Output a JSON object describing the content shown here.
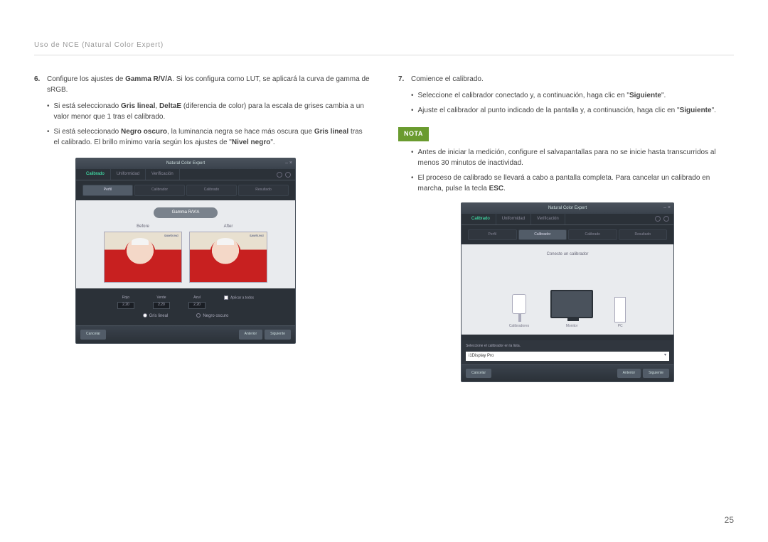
{
  "header": "Uso de NCE (Natural Color Expert)",
  "left": {
    "step6_num": "6.",
    "step6_a": "Configure los ajustes de ",
    "step6_b": "Gamma R/V/A",
    "step6_c": ". Si los configura como LUT, se aplicará la curva de gamma de sRGB.",
    "b1_a": "Si está seleccionado ",
    "b1_b": "Gris lineal",
    "b1_c": ", ",
    "b1_d": "DeltaE",
    "b1_e": " (diferencia de color) para la escala de grises cambia a un valor menor que 1 tras el calibrado.",
    "b2_a": "Si está seleccionado ",
    "b2_b": "Negro oscuro",
    "b2_c": ", la luminancia negra se hace más oscura que ",
    "b2_d": "Gris lineal",
    "b2_e": " tras el calibrado. El brillo mínimo varía según los ajustes de \"",
    "b2_f": "Nivel negro",
    "b2_g": "\"."
  },
  "right": {
    "step7_num": "7.",
    "step7": "Comience el calibrado.",
    "r1_a": "Seleccione el calibrador conectado y, a continuación, haga clic en \"",
    "r1_b": "Siguiente",
    "r1_c": "\".",
    "r2_a": "Ajuste el calibrador al punto indicado de la pantalla y, a continuación, haga clic en \"",
    "r2_b": "Siguiente",
    "r2_c": "\".",
    "nota": "NOTA",
    "n1": "Antes de iniciar la medición, configure el salvapantallas para no se inicie hasta transcurridos al menos 30 minutos de inactividad.",
    "n2_a": "El proceso de calibrado se llevará a cabo a pantalla completa. Para cancelar un calibrado en marcha, pulse la tecla ",
    "n2_b": "ESC",
    "n2_c": "."
  },
  "app1": {
    "title": "Natural Color Expert",
    "tabs": [
      "Calibrado",
      "Uniformidad",
      "Verificación"
    ],
    "steps": [
      "Perfil",
      "Calibrador",
      "Calibrado",
      "Resultado"
    ],
    "gamma_btn": "Gamma R/V/A",
    "before": "Before",
    "after": "After",
    "brand": "SAMSUNG",
    "sliders": [
      {
        "label": "Rojo",
        "val": "2.20"
      },
      {
        "label": "Verde",
        "val": "2.20"
      },
      {
        "label": "Azul",
        "val": "2.20"
      }
    ],
    "apply": "Aplicar a todos",
    "radio1": "Gris lineal",
    "radio2": "Negro oscuro",
    "cancel": "Cancelar",
    "prev": "Anterior",
    "next": "Siguiente"
  },
  "app2": {
    "title": "Natural Color Expert",
    "tabs": [
      "Calibrado",
      "Uniformidad",
      "Verificación"
    ],
    "steps": [
      "Perfil",
      "Calibrador",
      "Calibrado",
      "Resultado"
    ],
    "msg": "Conecte un calibrador",
    "dev1": "Calibradores",
    "dev2": "Monitor",
    "dev3": "PC",
    "select_label": "Seleccione el calibrador en la lista.",
    "select_value": "i1Display Pro",
    "cancel": "Cancelar",
    "prev": "Anterior",
    "next": "Siguiente"
  },
  "page_num": "25"
}
